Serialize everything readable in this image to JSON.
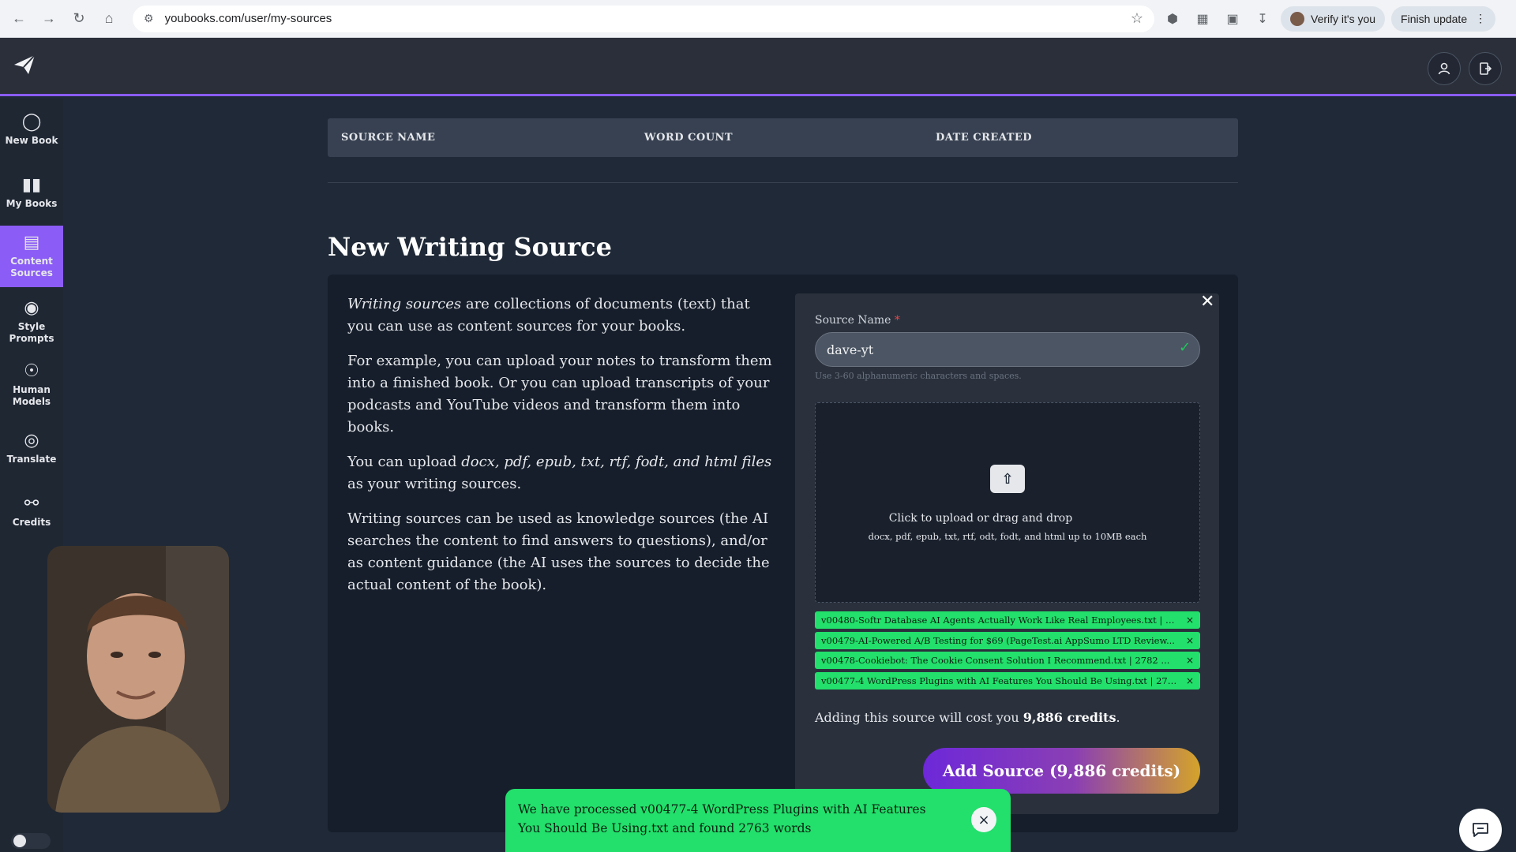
{
  "browser": {
    "url": "youbooks.com/user/my-sources",
    "verify_label": "Verify it's you",
    "update_label": "Finish update"
  },
  "sidebar": {
    "items": [
      {
        "label": "New Book",
        "icon": "lightbulb-icon"
      },
      {
        "label": "My Books",
        "icon": "books-icon"
      },
      {
        "label": "Content Sources",
        "icon": "archive-box-icon"
      },
      {
        "label": "Style Prompts",
        "icon": "palette-icon"
      },
      {
        "label": "Human Models",
        "icon": "head-brain-icon"
      },
      {
        "label": "Translate",
        "icon": "globe-icon"
      },
      {
        "label": "Credits",
        "icon": "piggy-bank-icon"
      }
    ],
    "active": "Content Sources"
  },
  "table": {
    "headers": [
      "SOURCE NAME",
      "WORD COUNT",
      "DATE CREATED"
    ]
  },
  "page_title": "New Writing Source",
  "description": {
    "p1_em": "Writing sources",
    "p1_rest": " are collections of documents (text) that you can use as content sources for your books.",
    "p2": "For example, you can upload your notes to transform them into a finished book. Or you can upload transcripts of your podcasts and YouTube videos and transform them into books.",
    "p3_pre": "You can upload ",
    "p3_em": "docx, pdf, epub, txt, rtf, fodt, and html files",
    "p3_post": " as your writing sources.",
    "p4": "Writing sources can be used as knowledge sources (the AI searches the content to find answers to questions), and/or as content guidance (the AI uses the sources to decide the actual content of the book)."
  },
  "form": {
    "name_label": "Source Name",
    "required_mark": "*",
    "name_value": "dave-yt",
    "name_hint": "Use 3-60 alphanumeric characters and spaces.",
    "upload_title": "Click to upload or drag and drop",
    "upload_sub": "docx, pdf, epub, txt, rtf, odt, fodt, and html up to 10MB each",
    "files": [
      "v00480-Softr Database AI Agents Actually Work Like Real Employees.txt | 2...",
      "v00479-AI-Powered A/B Testing for $69 (PageTest.ai AppSumo LTD Review...",
      "v00478-Cookiebot:   The Cookie Consent Solution I Recommend.txt | 2782 ...",
      "v00477-4 WordPress Plugins with AI Features You Should Be Using.txt | 276..."
    ],
    "cost_pre": "Adding this source will cost you ",
    "cost_amount": "9,886 credits",
    "cost_post": ".",
    "submit_label": "Add Source (9,886 credits)"
  },
  "toast": {
    "message": "We have processed v00477-4 WordPress Plugins with AI Features You Should Be Using.txt and found 2763 words"
  },
  "colors": {
    "accent": "#8b5cf6",
    "success": "#22e06b",
    "background": "#1f2937"
  }
}
